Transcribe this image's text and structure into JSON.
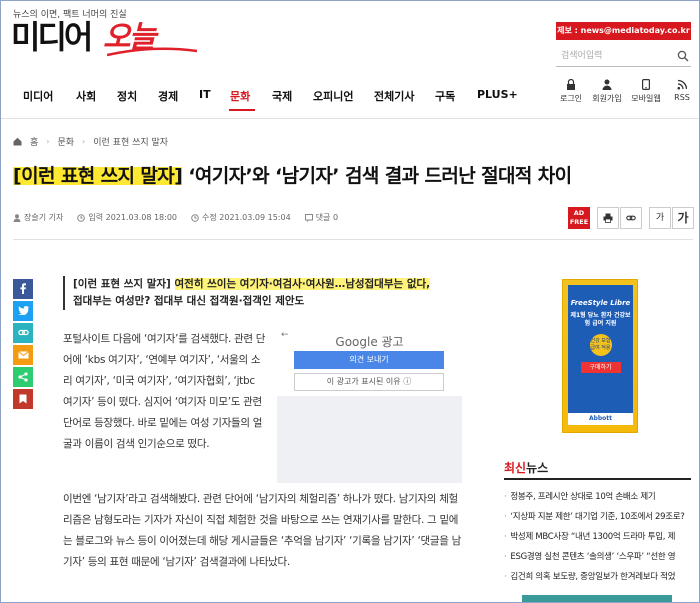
{
  "header": {
    "tagline": "뉴스의 이면, 팩트 너머의 진실",
    "logo_main": "미디어",
    "logo_script": "오늘",
    "report": "제보 : news@mediatoday.co.kr",
    "search_placeholder": "검색어입력"
  },
  "nav": {
    "items": [
      "미디어",
      "사회",
      "정치",
      "경제",
      "IT",
      "문화",
      "국제",
      "오피니언",
      "전체기사",
      "구독",
      "PLUS+"
    ],
    "active": "문화"
  },
  "util": [
    "로그인",
    "회원가입",
    "모바일웹",
    "RSS"
  ],
  "breadcrumb": [
    "홈",
    "문화",
    "이런 표현 쓰지 말자"
  ],
  "article": {
    "title_tag": "[이런 표현 쓰지 말자]",
    "title_rest": " ‘여기자’와 ‘남기자’ 검색 결과 드러난 절대적 차이",
    "author": "장슬기 기자",
    "published": "입력 2021.03.08 18:00",
    "modified": "수정 2021.03.09 15:04",
    "comments": "댓글 0",
    "adfree": [
      "AD",
      "FREE"
    ],
    "font_small": "가",
    "font_large": "가",
    "lead_tag": "[이런 표현 쓰지 말자]",
    "lead_hl": "여전히 쓰이는 여기자·여검사·여사원…남성접대부는 없다,",
    "lead_rest": "접대부는 여성만? 접대부 대신 접객원·접객인 제안도",
    "p1": "포털사이트 다음에 ‘여기자’를 검색했다. 관련 단어에 ‘kbs 여기자’, ‘연예부 여기자’, ‘서울의 소리 여기자’, ‘미국 여기자’, ‘여기자협회’, ‘jtbc 여기자’ 등이 떴다. 심지어 ‘여기자 미모’도 관련 단어로 등장했다. 바로 밑에는 여성 기자들의 얼굴과 이름이 검색 인기순으로 떴다.",
    "p2": "이번엔 ‘남기자’라고 검색해봤다. 관련 단어에 ‘남기자의 체헐리즘’ 하나가 떴다. 남기자의 체헐리즘은 남형도라는 기자가 자신이 직접 체험한 것을 바탕으로 쓰는 연재기사를 말한다. 그 밑에는 블로그와 뉴스 등이 이어졌는데 해당 게시글들은 ‘추억을 남기자’ ‘기록을 남기자’ ‘댓글을 남기자’ 등의 표현 때문에 ‘남기자’ 검색결과에 나타났다."
  },
  "share": [
    {
      "icon": "facebook-icon",
      "color": "#3b5998"
    },
    {
      "icon": "twitter-icon",
      "color": "#1da1f2"
    },
    {
      "icon": "link-icon",
      "color": "#2bb3c0"
    },
    {
      "icon": "email-icon",
      "color": "#f39c12"
    },
    {
      "icon": "share-icon",
      "color": "#2ecc71"
    },
    {
      "icon": "bookmark-icon",
      "color": "#c0392b"
    }
  ],
  "google_ad": {
    "logo": "Google 광고",
    "send": "의견 보내기",
    "why": "이 광고가 표시된 이유 ⓘ"
  },
  "side_ad": {
    "brand": "FreeStyle Libre",
    "copy": "제1형 당뇨 환자 건강보험 급여 지원",
    "badge": "건강 보험급여 적용",
    "button": "구매하기",
    "foot": "Abbott"
  },
  "latest": {
    "title_red": "최신",
    "title_rest": "뉴스",
    "items": [
      "정봉주, 프레시안 상대로 10억 손배소 제기",
      "‘지상파 지분 제한’ 대기업 기준, 10조에서 29조로?",
      "박성제 MBC사장 “내년 1300억 드라마 투입, 제",
      "ESG경영 실천 콘텐츠 ‘솔의생’ ‘스우파’ “선한 영",
      "김건희 의혹 보도량, 중앙일보가 한겨레보다 적었"
    ]
  },
  "colors": {
    "accent": "#d7191f",
    "highlight": "#ffe832"
  }
}
